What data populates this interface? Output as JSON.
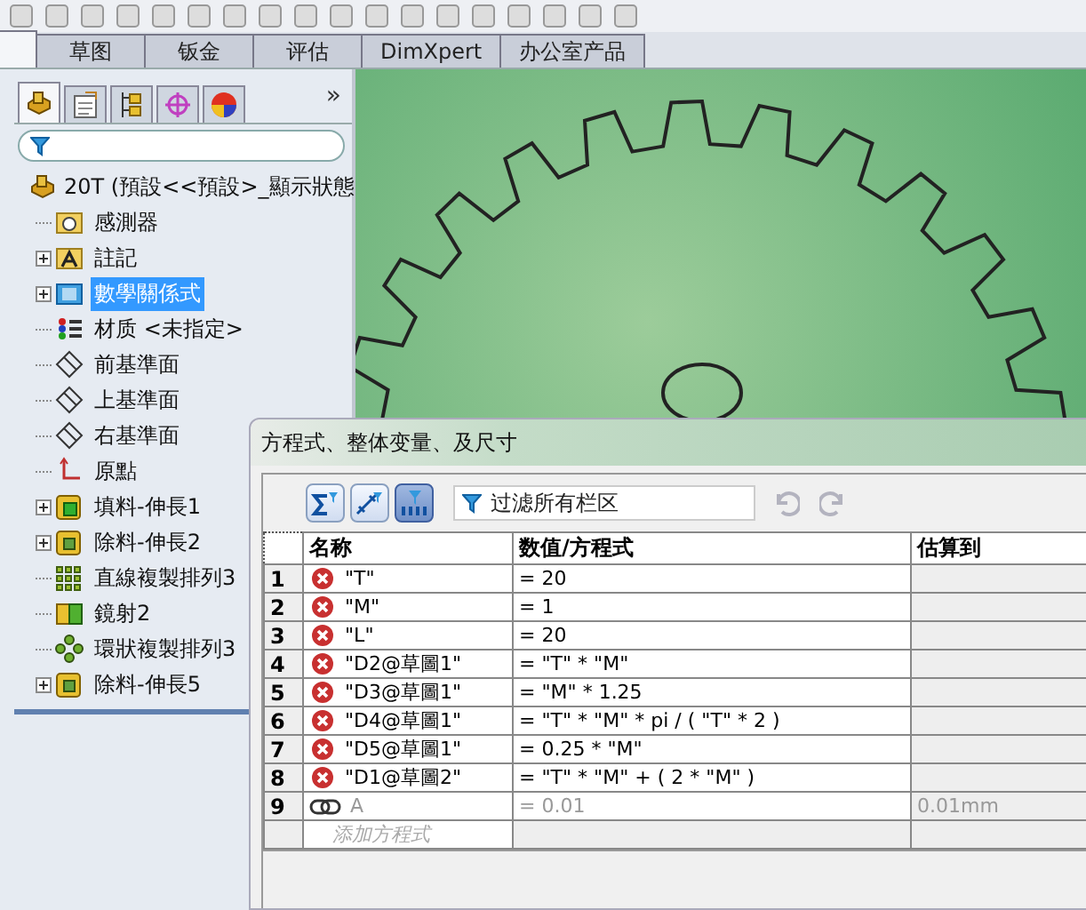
{
  "command_tabs": [
    {
      "selected": true
    },
    {
      "label": "草图",
      "selected": false
    },
    {
      "label": "钣金",
      "selected": false
    },
    {
      "label": "评估",
      "selected": false
    },
    {
      "label": "DimXpert",
      "selected": false
    },
    {
      "label": "办公室产品",
      "selected": false
    }
  ],
  "panel_tabs": [
    {
      "kind": "part",
      "selected": true
    },
    {
      "kind": "property",
      "selected": false
    },
    {
      "kind": "config",
      "selected": false
    },
    {
      "kind": "target",
      "selected": false
    },
    {
      "kind": "display",
      "selected": false
    }
  ],
  "panel_more": "»",
  "tree": {
    "root": "20T  (預設<<預設>_顯示狀態",
    "items": [
      {
        "label": "感測器",
        "kind": "sensor",
        "expandable": false,
        "selected": false
      },
      {
        "label": "註記",
        "kind": "annotation",
        "expandable": true,
        "selected": false
      },
      {
        "label": "數學關係式",
        "kind": "equations",
        "expandable": true,
        "selected": true
      },
      {
        "label": "材质 <未指定>",
        "kind": "material",
        "expandable": false,
        "selected": false
      },
      {
        "label": "前基準面",
        "kind": "plane",
        "expandable": false,
        "selected": false
      },
      {
        "label": "上基準面",
        "kind": "plane",
        "expandable": false,
        "selected": false
      },
      {
        "label": "右基準面",
        "kind": "plane",
        "expandable": false,
        "selected": false
      },
      {
        "label": "原點",
        "kind": "origin",
        "expandable": false,
        "selected": false
      },
      {
        "label": "填料-伸長1",
        "kind": "boss",
        "expandable": true,
        "selected": false
      },
      {
        "label": "除料-伸長2",
        "kind": "cut",
        "expandable": true,
        "selected": false
      },
      {
        "label": "直線複製排列3",
        "kind": "linear_pattern",
        "expandable": false,
        "selected": false
      },
      {
        "label": "鏡射2",
        "kind": "mirror",
        "expandable": false,
        "selected": false
      },
      {
        "label": "環狀複製排列3",
        "kind": "circular_pattern",
        "expandable": false,
        "selected": false
      },
      {
        "label": "除料-伸長5",
        "kind": "cut",
        "expandable": true,
        "selected": false
      }
    ]
  },
  "dialog": {
    "title": "方程式、整体变量、及尺寸",
    "view_buttons": [
      {
        "kind": "equations",
        "selected": false
      },
      {
        "kind": "dimensions",
        "selected": false
      },
      {
        "kind": "ordered",
        "selected": true
      }
    ],
    "filter": {
      "placeholder": "过滤所有栏区"
    },
    "undo": {
      "disabled": true
    },
    "redo": {
      "disabled": true
    },
    "table": {
      "columns": [
        "名称",
        "数值/方程式",
        "估算到"
      ],
      "rows": [
        {
          "number": "1",
          "kind": "error",
          "name": "\"T\"",
          "value": "= 20",
          "evaluates_to": ""
        },
        {
          "number": "2",
          "kind": "error",
          "name": "\"M\"",
          "value": "= 1",
          "evaluates_to": ""
        },
        {
          "number": "3",
          "kind": "error",
          "name": "\"L\"",
          "value": "= 20",
          "evaluates_to": ""
        },
        {
          "number": "4",
          "kind": "error",
          "name": "\"D2@草圖1\"",
          "value": "= \"T\" * \"M\"",
          "evaluates_to": ""
        },
        {
          "number": "5",
          "kind": "error",
          "name": "\"D3@草圖1\"",
          "value": "= \"M\" * 1.25",
          "evaluates_to": ""
        },
        {
          "number": "6",
          "kind": "error",
          "name": "\"D4@草圖1\"",
          "value": "= \"T\" * \"M\" * pi / ( \"T\" * 2 )",
          "evaluates_to": ""
        },
        {
          "number": "7",
          "kind": "error",
          "name": "\"D5@草圖1\"",
          "value": "= 0.25 * \"M\"",
          "evaluates_to": ""
        },
        {
          "number": "8",
          "kind": "error",
          "name": "\"D1@草圖2\"",
          "value": "= \"T\" * \"M\" + ( 2 * \"M\" )",
          "evaluates_to": ""
        },
        {
          "number": "9",
          "kind": "link",
          "name": "A",
          "value": "= 0.01",
          "evaluates_to": "0.01mm"
        }
      ],
      "add_row": {
        "placeholder": "添加方程式"
      }
    }
  }
}
